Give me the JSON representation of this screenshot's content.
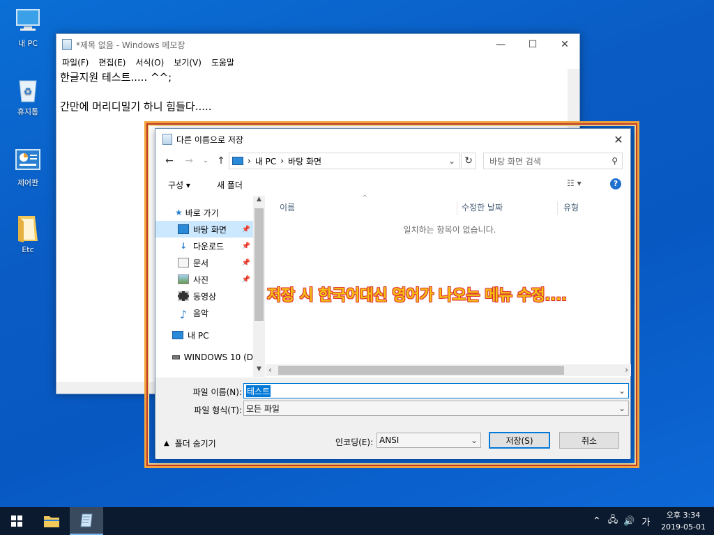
{
  "desktop": {
    "icons": [
      {
        "label": "내 PC"
      },
      {
        "label": "휴지통"
      },
      {
        "label": "제어판"
      },
      {
        "label": "Etc"
      }
    ]
  },
  "notepad": {
    "title": "*제목 없음 - Windows 메모장",
    "menu": [
      "파일(F)",
      "편집(E)",
      "서식(O)",
      "보기(V)",
      "도움말"
    ],
    "line1": "한글지원 테스트..... ^^;",
    "line2": "간만에 머리디밀기 하니 힘들다....."
  },
  "dialog": {
    "title": "다른 이름으로 저장",
    "breadcrumb": [
      "내 PC",
      "바탕 화면"
    ],
    "search_placeholder": "바탕 화면 검색",
    "toolbar": {
      "organize": "구성 ▾",
      "new_folder": "새 폴더"
    },
    "nav": {
      "quick_access": "바로 가기",
      "items": [
        "바탕 화면",
        "다운로드",
        "문서",
        "사진",
        "동영상",
        "음악"
      ],
      "this_pc": "내 PC",
      "drive": "WINDOWS 10 (D"
    },
    "columns": [
      "이름",
      "수정한 날짜",
      "유형"
    ],
    "empty_message": "일치하는 항목이 없습니다.",
    "filename_label": "파일 이름(N):",
    "filename_value": "테스트",
    "filetype_label": "파일 형식(T):",
    "filetype_value": "모든 파일",
    "hide_folders": "폴더 숨기기",
    "encoding_label": "인코딩(E):",
    "encoding_value": "ANSI",
    "save_button": "저장(S)",
    "cancel_button": "취소"
  },
  "annotation": "저장 시 한국어대신 영어가 나오는 메뉴 수정....",
  "taskbar": {
    "ime": "가",
    "time": "오후 3:34",
    "date": "2019-05-01"
  }
}
